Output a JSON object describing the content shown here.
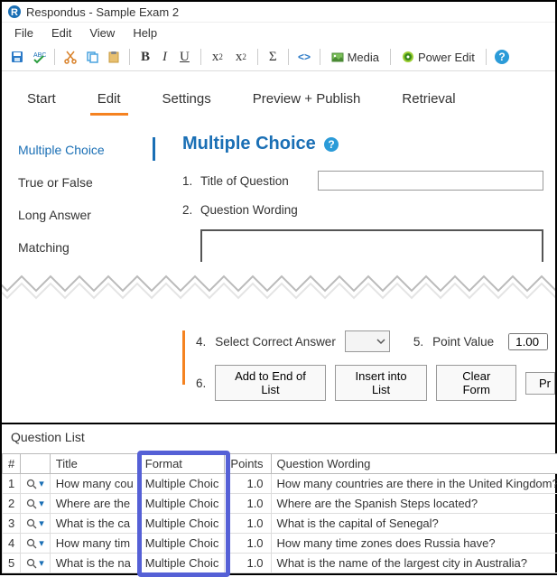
{
  "app": {
    "title": "Respondus - Sample Exam 2"
  },
  "menu": [
    "File",
    "Edit",
    "View",
    "Help"
  ],
  "toolbar": {
    "bold": "B",
    "italic": "I",
    "underline": "U",
    "sub": "x",
    "sup": "x",
    "sigma": "Σ",
    "media": "Media",
    "power": "Power Edit"
  },
  "tabs": {
    "items": [
      "Start",
      "Edit",
      "Settings",
      "Preview + Publish",
      "Retrieval"
    ],
    "active": "Edit"
  },
  "sidebar": {
    "items": [
      "Multiple Choice",
      "True or False",
      "Long Answer",
      "Matching"
    ],
    "active": "Multiple Choice"
  },
  "editor": {
    "heading": "Multiple Choice",
    "fields": {
      "f1_num": "1.",
      "f1_label": "Title of Question",
      "f2_num": "2.",
      "f2_label": "Question Wording",
      "f4_num": "4.",
      "f4_label": "Select Correct Answer",
      "f5_num": "5.",
      "f5_label": "Point Value",
      "f5_value": "1.00",
      "f6_num": "6.",
      "btn_add": "Add to End of List",
      "btn_insert": "Insert into List",
      "btn_clear": "Clear Form",
      "btn_preview": "Pr"
    }
  },
  "qlist": {
    "title": "Question List",
    "headers": {
      "num": "#",
      "title": "Title",
      "format": "Format",
      "points": "Points",
      "wording": "Question Wording"
    },
    "rows": [
      {
        "n": "1",
        "title": "How many cou",
        "format": "Multiple Choic",
        "points": "1.0",
        "wording": "How many countries are there in the United Kingdom?"
      },
      {
        "n": "2",
        "title": "Where are the",
        "format": "Multiple Choic",
        "points": "1.0",
        "wording": "Where are the Spanish Steps located?"
      },
      {
        "n": "3",
        "title": "What is the ca",
        "format": "Multiple Choic",
        "points": "1.0",
        "wording": "What is the capital of Senegal?"
      },
      {
        "n": "4",
        "title": "How many tim",
        "format": "Multiple Choic",
        "points": "1.0",
        "wording": "How many time zones does Russia have?"
      },
      {
        "n": "5",
        "title": "What is the na",
        "format": "Multiple Choic",
        "points": "1.0",
        "wording": "What is the name of the largest city in Australia?"
      }
    ]
  }
}
